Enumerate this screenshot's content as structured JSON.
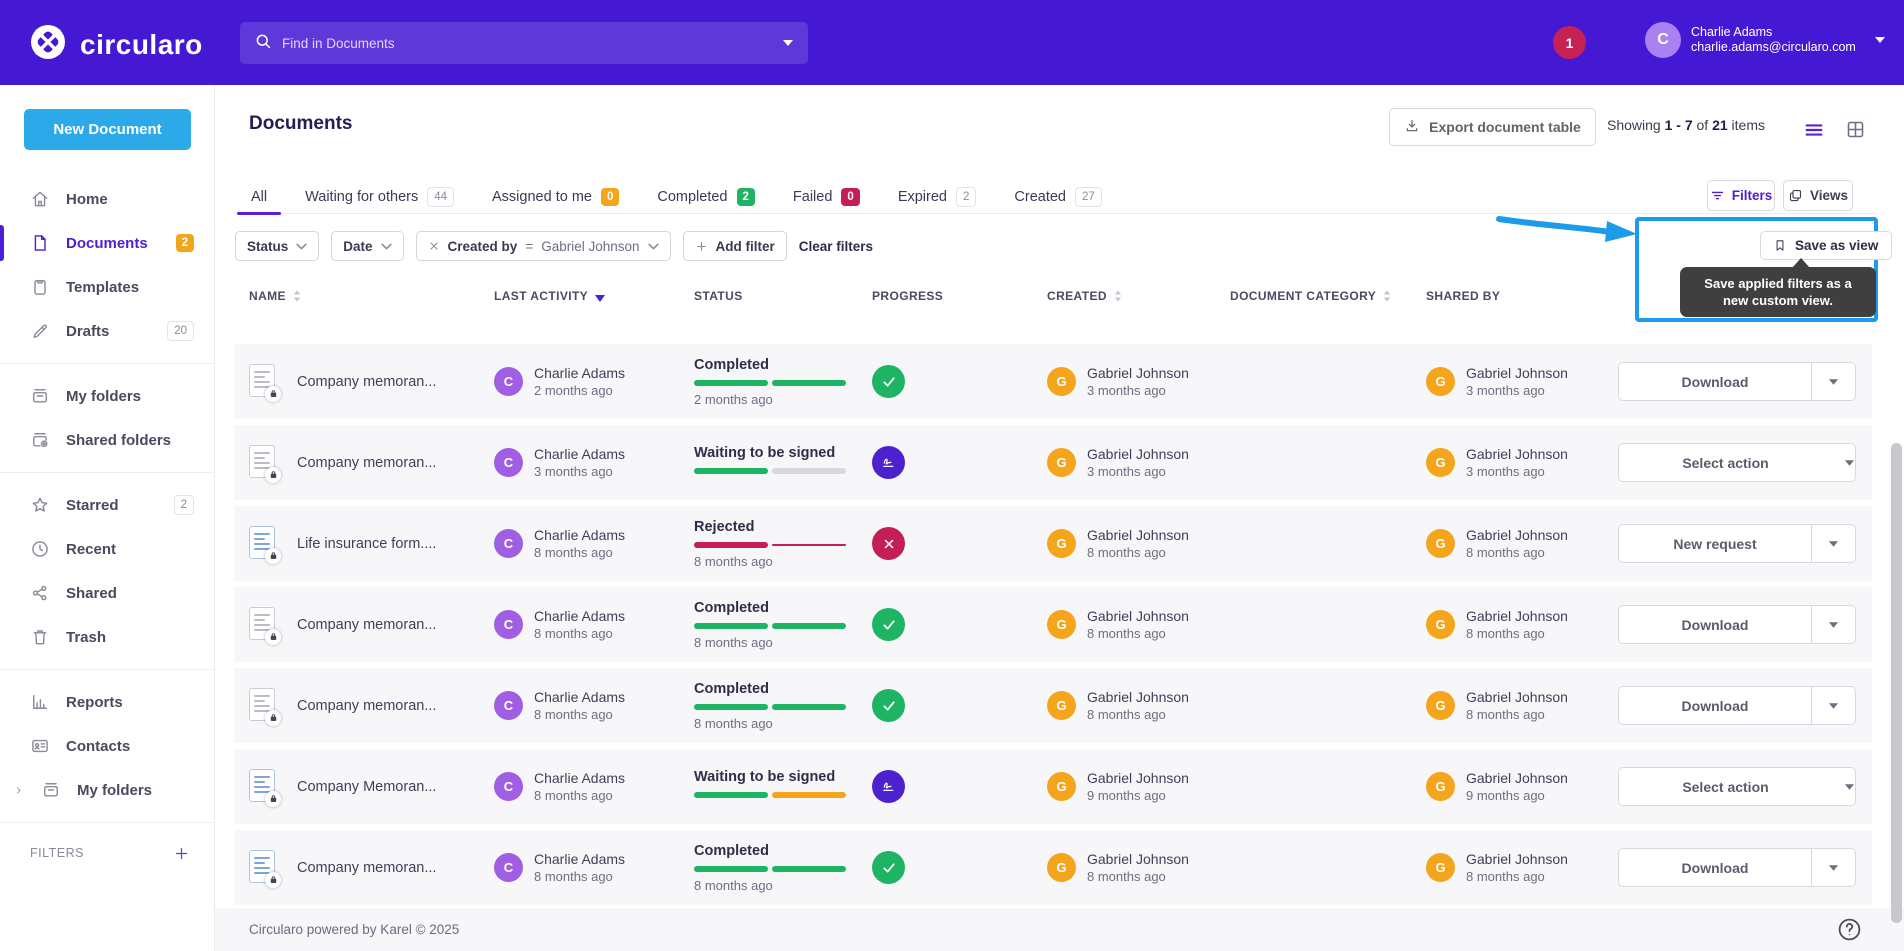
{
  "colors": {
    "brand_purple": "#4518D4",
    "accent_purple": "#4C1FD6",
    "action_blue": "#2BA9E8",
    "highlight_cyan": "#1B9BE8",
    "green": "#1FB364",
    "orange": "#F5A51C",
    "crimson": "#C41F55"
  },
  "topbar": {
    "brand": "circularo",
    "search": {
      "placeholder": "Find in Documents",
      "icons": [
        "search-icon",
        "caret-down-icon"
      ]
    },
    "notification_count": "1",
    "user": {
      "initial": "C",
      "name": "Charlie Adams",
      "email": "charlie.adams@circularo.com"
    }
  },
  "sidebar": {
    "new_document_label": "New Document",
    "sections": [
      {
        "items": [
          {
            "icon": "home-icon",
            "label": "Home"
          },
          {
            "icon": "document-icon",
            "label": "Documents",
            "active": true,
            "badge": {
              "text": "2",
              "style": "orange"
            }
          },
          {
            "icon": "template-icon",
            "label": "Templates"
          },
          {
            "icon": "draft-icon",
            "label": "Drafts",
            "badge": {
              "text": "20",
              "style": "outline"
            }
          }
        ]
      },
      {
        "items": [
          {
            "icon": "folder-icon",
            "label": "My folders"
          },
          {
            "icon": "folder-shared-icon",
            "label": "Shared folders"
          }
        ]
      },
      {
        "items": [
          {
            "icon": "star-icon",
            "label": "Starred",
            "badge": {
              "text": "2",
              "style": "outline"
            }
          },
          {
            "icon": "clock-icon",
            "label": "Recent"
          },
          {
            "icon": "share-icon",
            "label": "Shared"
          },
          {
            "icon": "trash-icon",
            "label": "Trash"
          }
        ]
      },
      {
        "items": [
          {
            "icon": "chart-icon",
            "label": "Reports"
          },
          {
            "icon": "contacts-icon",
            "label": "Contacts"
          },
          {
            "icon": "folder-icon",
            "label": "My folders",
            "chevron": true
          }
        ]
      }
    ],
    "filters_label": "FILTERS"
  },
  "header": {
    "title": "Documents",
    "export_label": "Export document table",
    "showing": {
      "prefix": "Showing",
      "range": "1 - 7",
      "of": "of",
      "total": "21",
      "suffix": "items"
    }
  },
  "tabs": [
    {
      "label": "All",
      "active": true
    },
    {
      "label": "Waiting for others",
      "count": "44",
      "style": "outline"
    },
    {
      "label": "Assigned to me",
      "count": "0",
      "style": "orange"
    },
    {
      "label": "Completed",
      "count": "2",
      "style": "green"
    },
    {
      "label": "Failed",
      "count": "0",
      "style": "crimson"
    },
    {
      "label": "Expired",
      "count": "2",
      "style": "outline"
    },
    {
      "label": "Created",
      "count": "27",
      "style": "outline"
    }
  ],
  "toolbar": {
    "filters_label": "Filters",
    "views_label": "Views"
  },
  "chips": {
    "status_label": "Status",
    "date_label": "Date",
    "created_by": {
      "field": "Created by",
      "op": "=",
      "value": "Gabriel Johnson"
    },
    "add_filter_label": "Add filter",
    "clear_label": "Clear filters"
  },
  "save_view": {
    "button_label": "Save as view",
    "tooltip": "Save applied filters as a new custom view."
  },
  "table": {
    "columns": [
      {
        "label": "NAME",
        "sort": "both"
      },
      {
        "label": "LAST ACTIVITY",
        "sort": "desc"
      },
      {
        "label": "STATUS"
      },
      {
        "label": "PROGRESS"
      },
      {
        "label": "CREATED",
        "sort": "both"
      },
      {
        "label": "DOCUMENT CATEGORY",
        "sort": "both"
      },
      {
        "label": "SHARED BY"
      }
    ],
    "rows": [
      {
        "name": "Company memoran...",
        "doc_tint": "gray",
        "activity": {
          "initial": "C",
          "name": "Charlie Adams",
          "time": "2 months ago"
        },
        "status": {
          "label": "Completed",
          "time": "2 months ago",
          "bar": [
            "green",
            "green"
          ]
        },
        "result": "check",
        "created": {
          "initial": "G",
          "name": "Gabriel Johnson",
          "time": "3 months ago"
        },
        "shared": {
          "initial": "G",
          "name": "Gabriel Johnson",
          "time": "3 months ago"
        },
        "action": {
          "label": "Download",
          "split": true
        }
      },
      {
        "name": "Company memoran...",
        "doc_tint": "gray",
        "activity": {
          "initial": "C",
          "name": "Charlie Adams",
          "time": "3 months ago"
        },
        "status": {
          "label": "Waiting to be signed",
          "time": "",
          "bar": [
            "green",
            "gray"
          ]
        },
        "result": "sign",
        "created": {
          "initial": "G",
          "name": "Gabriel Johnson",
          "time": "3 months ago"
        },
        "shared": {
          "initial": "G",
          "name": "Gabriel Johnson",
          "time": "3 months ago"
        },
        "action": {
          "label": "Select action",
          "split": false
        }
      },
      {
        "name": "Life insurance form....",
        "doc_tint": "blue",
        "activity": {
          "initial": "C",
          "name": "Charlie Adams",
          "time": "8 months ago"
        },
        "status": {
          "label": "Rejected",
          "time": "8 months ago",
          "bar": [
            "crimson",
            "thin"
          ]
        },
        "result": "cross",
        "created": {
          "initial": "G",
          "name": "Gabriel Johnson",
          "time": "8 months ago"
        },
        "shared": {
          "initial": "G",
          "name": "Gabriel Johnson",
          "time": "8 months ago"
        },
        "action": {
          "label": "New request",
          "split": true
        }
      },
      {
        "name": "Company memoran...",
        "doc_tint": "gray",
        "activity": {
          "initial": "C",
          "name": "Charlie Adams",
          "time": "8 months ago"
        },
        "status": {
          "label": "Completed",
          "time": "8 months ago",
          "bar": [
            "green",
            "green"
          ]
        },
        "result": "check",
        "created": {
          "initial": "G",
          "name": "Gabriel Johnson",
          "time": "8 months ago"
        },
        "shared": {
          "initial": "G",
          "name": "Gabriel Johnson",
          "time": "8 months ago"
        },
        "action": {
          "label": "Download",
          "split": true
        }
      },
      {
        "name": "Company memoran...",
        "doc_tint": "gray",
        "activity": {
          "initial": "C",
          "name": "Charlie Adams",
          "time": "8 months ago"
        },
        "status": {
          "label": "Completed",
          "time": "8 months ago",
          "bar": [
            "green",
            "green"
          ]
        },
        "result": "check",
        "created": {
          "initial": "G",
          "name": "Gabriel Johnson",
          "time": "8 months ago"
        },
        "shared": {
          "initial": "G",
          "name": "Gabriel Johnson",
          "time": "8 months ago"
        },
        "action": {
          "label": "Download",
          "split": true
        }
      },
      {
        "name": "Company Memoran...",
        "doc_tint": "blue",
        "activity": {
          "initial": "C",
          "name": "Charlie Adams",
          "time": "8 months ago"
        },
        "status": {
          "label": "Waiting to be signed",
          "time": "",
          "bar": [
            "green",
            "orange"
          ]
        },
        "result": "sign",
        "created": {
          "initial": "G",
          "name": "Gabriel Johnson",
          "time": "9 months ago"
        },
        "shared": {
          "initial": "G",
          "name": "Gabriel Johnson",
          "time": "9 months ago"
        },
        "action": {
          "label": "Select action",
          "split": false
        }
      },
      {
        "name": "Company memoran...",
        "doc_tint": "blue",
        "activity": {
          "initial": "C",
          "name": "Charlie Adams",
          "time": "8 months ago"
        },
        "status": {
          "label": "Completed",
          "time": "8 months ago",
          "bar": [
            "green",
            "green"
          ]
        },
        "result": "check",
        "created": {
          "initial": "G",
          "name": "Gabriel Johnson",
          "time": "8 months ago"
        },
        "shared": {
          "initial": "G",
          "name": "Gabriel Johnson",
          "time": "8 months ago"
        },
        "action": {
          "label": "Download",
          "split": true
        }
      }
    ]
  },
  "footer": {
    "text": "Circularo powered by Karel © 2025"
  }
}
